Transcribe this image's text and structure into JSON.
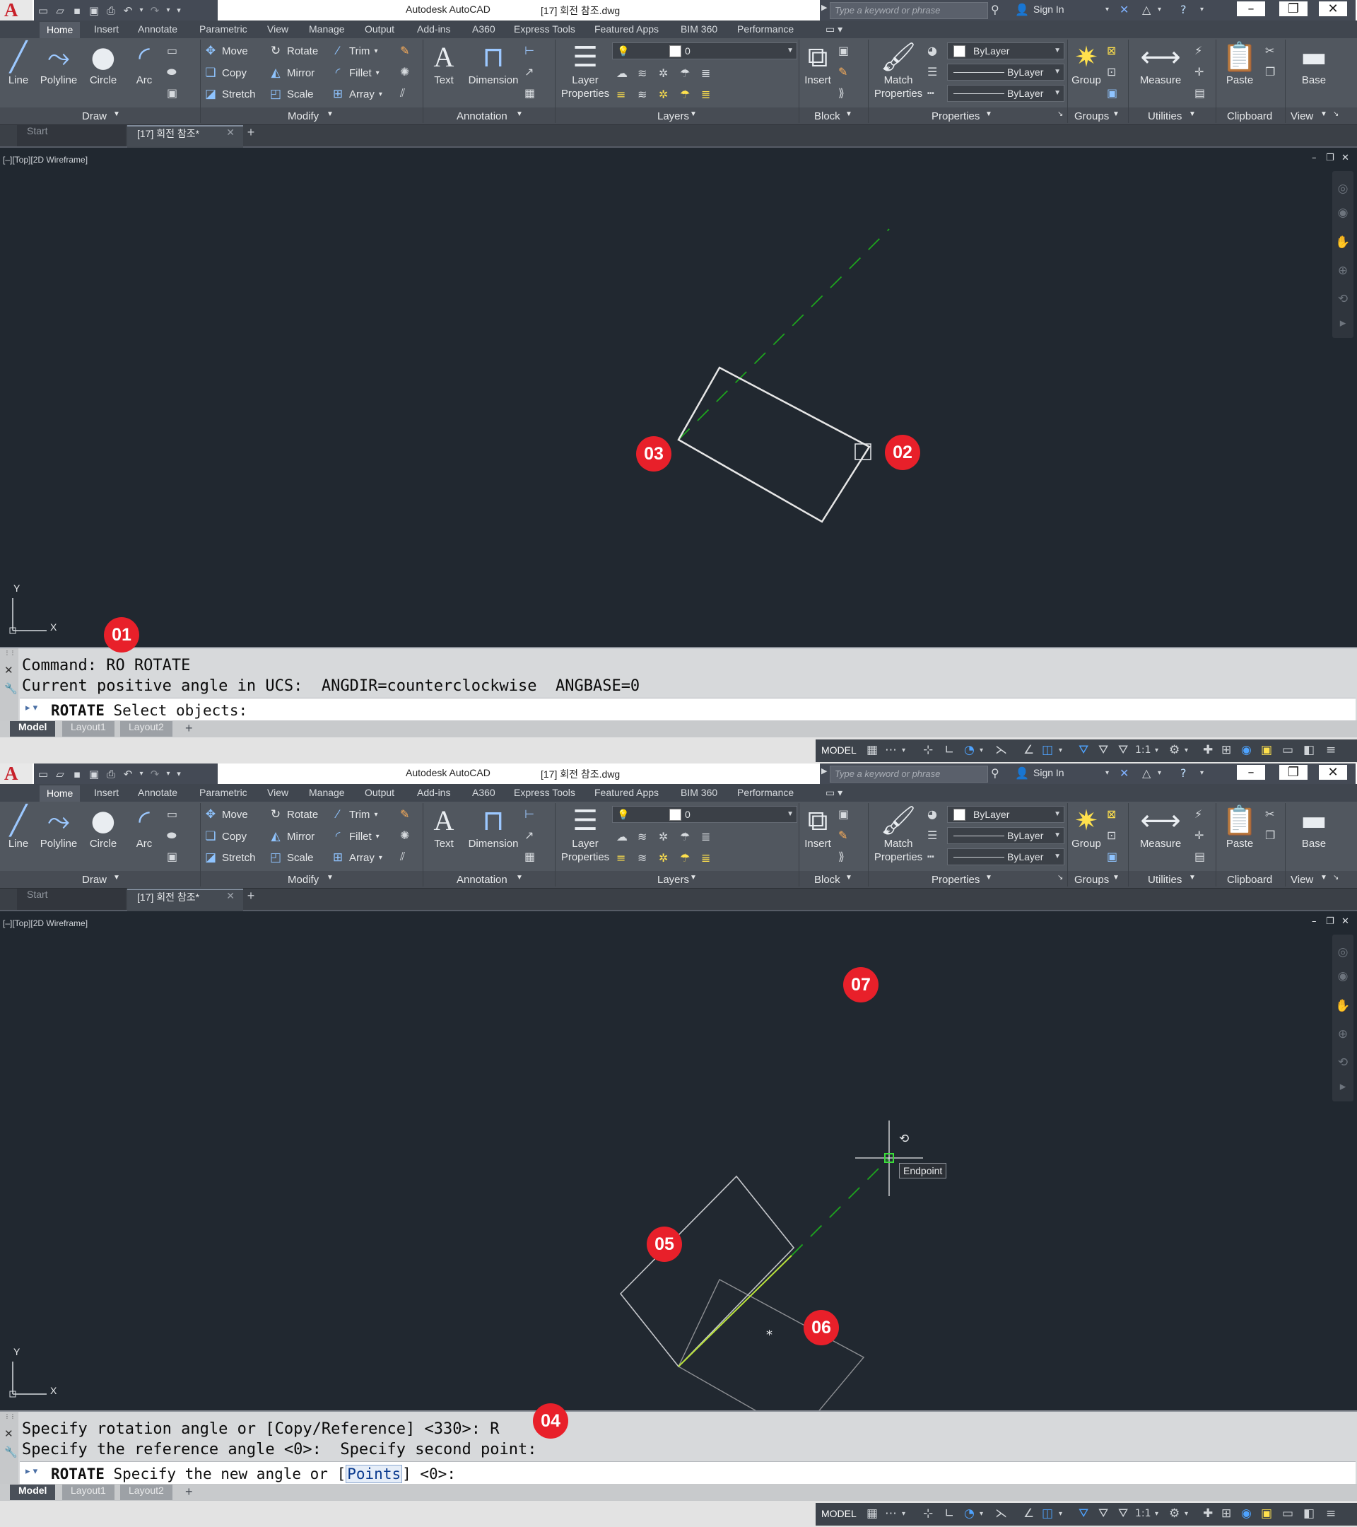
{
  "app": {
    "name": "Autodesk AutoCAD",
    "document": "[17] 회전 참조.dwg",
    "search_placeholder": "Type a keyword or phrase",
    "sign_in": "Sign In"
  },
  "ribbon": {
    "tabs": [
      "Home",
      "Insert",
      "Annotate",
      "Parametric",
      "View",
      "Manage",
      "Output",
      "Add-ins",
      "A360",
      "Express Tools",
      "Featured Apps",
      "BIM 360",
      "Performance"
    ],
    "draw": {
      "line": "Line",
      "polyline": "Polyline",
      "circle": "Circle",
      "arc": "Arc",
      "label": "Draw"
    },
    "modify": {
      "move": "Move",
      "rotate": "Rotate",
      "trim": "Trim",
      "copy": "Copy",
      "mirror": "Mirror",
      "fillet": "Fillet",
      "stretch": "Stretch",
      "scale": "Scale",
      "array": "Array",
      "label": "Modify"
    },
    "annotation": {
      "text": "Text",
      "dimension": "Dimension",
      "label": "Annotation"
    },
    "layers": {
      "layer_properties_1": "Layer",
      "layer_properties_2": "Properties",
      "current_layer": "0",
      "label": "Layers"
    },
    "block": {
      "insert": "Insert",
      "label": "Block"
    },
    "properties": {
      "match_1": "Match",
      "match_2": "Properties",
      "color": "ByLayer",
      "linetype": "ByLayer",
      "lineweight": "ByLayer",
      "label": "Properties"
    },
    "groups": {
      "group": "Group",
      "label": "Groups"
    },
    "utilities": {
      "measure": "Measure",
      "label": "Utilities"
    },
    "clipboard": {
      "paste": "Paste",
      "label": "Clipboard"
    },
    "view": {
      "base": "Base",
      "label": "View"
    }
  },
  "file_tabs": {
    "start": "Start",
    "doc": "[17] 회전 참조*"
  },
  "viewport": {
    "label": "[–][Top][2D Wireframe]",
    "ucs_x": "X",
    "ucs_y": "Y"
  },
  "layout_tabs": [
    "Model",
    "Layout1",
    "Layout2"
  ],
  "status": {
    "model": "MODEL",
    "scale": "1:1"
  },
  "panel1": {
    "markers": [
      "01",
      "02",
      "03"
    ],
    "command_history": [
      "Command: RO ROTATE",
      "Current positive angle in UCS:  ANGDIR=counterclockwise  ANGBASE=0"
    ],
    "prompt_cmd": "ROTATE",
    "prompt_text": "Select objects:"
  },
  "panel2": {
    "markers": [
      "07",
      "05",
      "06",
      "04"
    ],
    "tooltip": "Endpoint",
    "command_history": [
      "Specify rotation angle or [Copy/Reference] <330>: R",
      "Specify the reference angle <0>:  Specify second point:"
    ],
    "prompt_cmd": "ROTATE",
    "prompt_text_before": "Specify the new angle or [",
    "prompt_keyword": "Points",
    "prompt_text_after": "] <0>:"
  },
  "colors": {
    "background": "#212830",
    "ribbon": "#51575f",
    "marker": "#e8202a",
    "green_line": "#1ea51e",
    "yellow_green": "#b9e23a",
    "rect_white": "#e6e6e6",
    "rect_gray": "#8d8f93"
  }
}
